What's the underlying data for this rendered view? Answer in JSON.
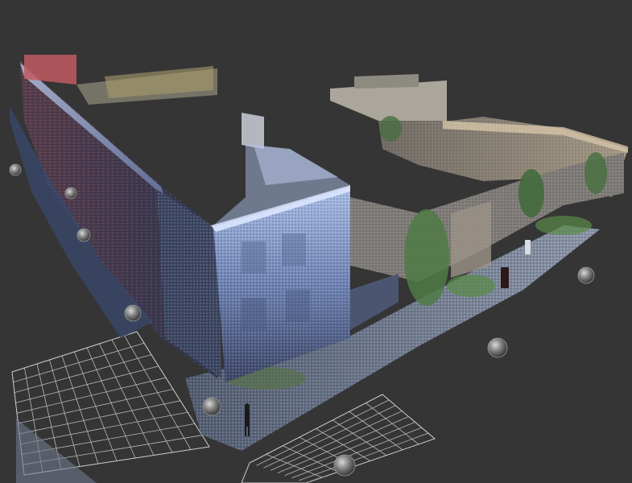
{
  "viewer": {
    "background": "#353535",
    "scan_colors": {
      "facade_blue": "#7f95c6",
      "facade_dark": "#3b4460",
      "brick": "#6a4a52",
      "courtyard": "#8a7f6e",
      "vegetation": "#4f7a45",
      "street": "#6f7a8c"
    },
    "sphere_count": 9,
    "floor_grids": 2,
    "icons": [
      "scan-position-sphere-icon",
      "floor-grid-icon"
    ]
  }
}
